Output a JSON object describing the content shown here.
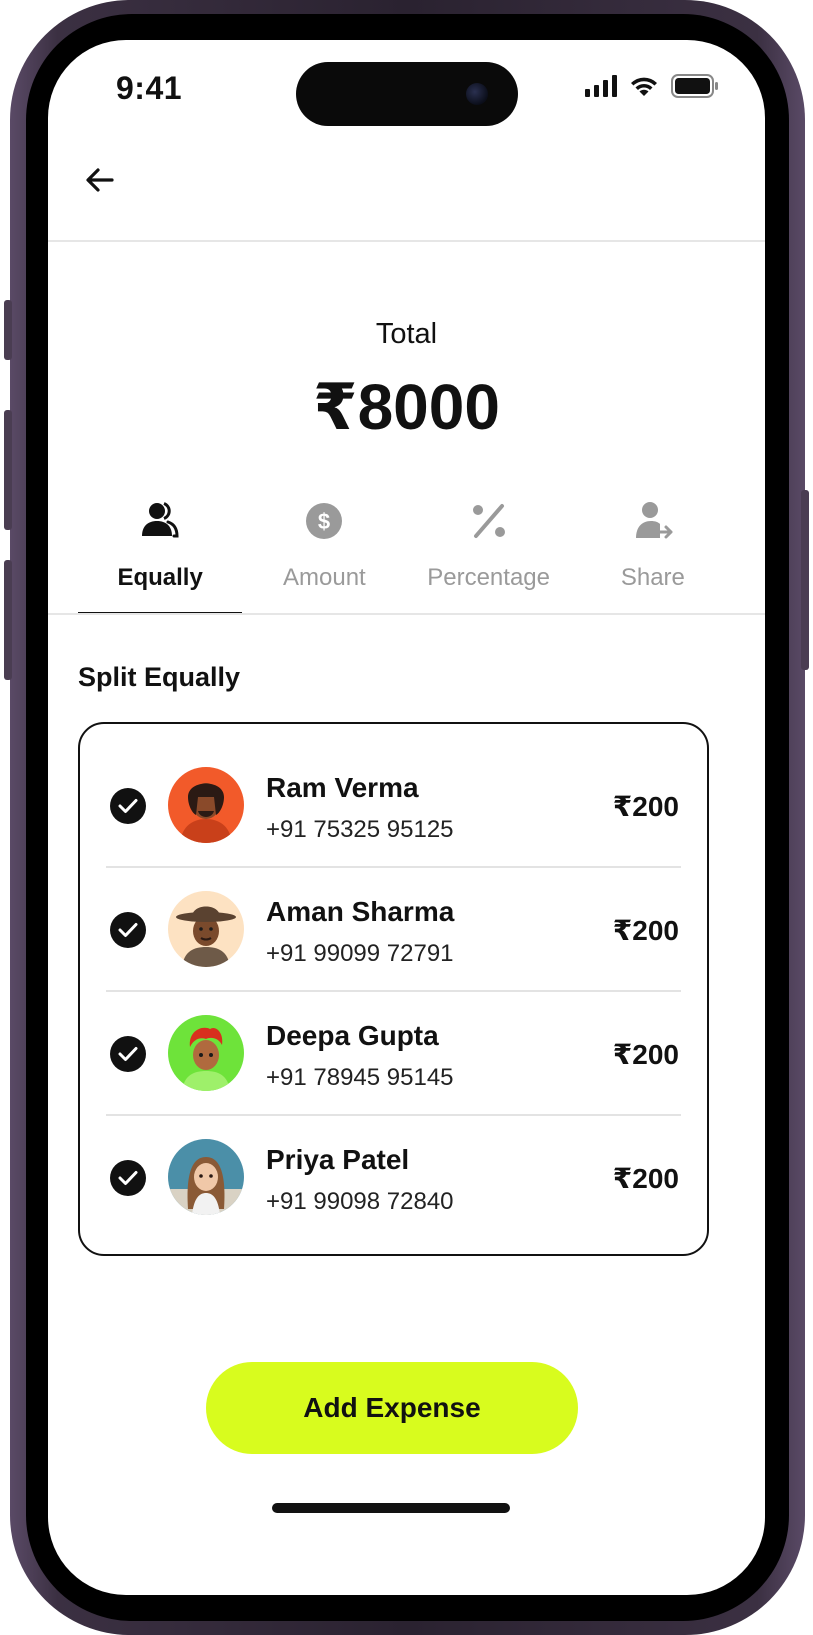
{
  "status_bar": {
    "time": "9:41"
  },
  "header": {
    "back_icon": "arrow-left-icon"
  },
  "total": {
    "label": "Total",
    "amount": "₹8000"
  },
  "tabs": [
    {
      "label": "Equally",
      "icon": "users-icon",
      "active": true
    },
    {
      "label": "Amount",
      "icon": "dollar-circle-icon",
      "active": false
    },
    {
      "label": "Percentage",
      "icon": "percent-icon",
      "active": false
    },
    {
      "label": "Share",
      "icon": "user-share-icon",
      "active": false
    }
  ],
  "section_title": "Split Equally",
  "members": [
    {
      "name": "Ram Verma",
      "phone": "+91 75325 95125",
      "share": "₹200",
      "checked": true,
      "avatar_bg": "#f25a2a"
    },
    {
      "name": "Aman Sharma",
      "phone": "+91 99099 72791",
      "share": "₹200",
      "checked": true,
      "avatar_bg": "#fde2c2"
    },
    {
      "name": "Deepa Gupta",
      "phone": "+91 78945 95145",
      "share": "₹200",
      "checked": true,
      "avatar_bg": "#6ee33a"
    },
    {
      "name": "Priya Patel",
      "phone": "+91 99098 72840",
      "share": "₹200",
      "checked": true,
      "avatar_bg": "#4b8fa8"
    }
  ],
  "action": {
    "label": "Add Expense",
    "color": "#d8fc1e"
  }
}
